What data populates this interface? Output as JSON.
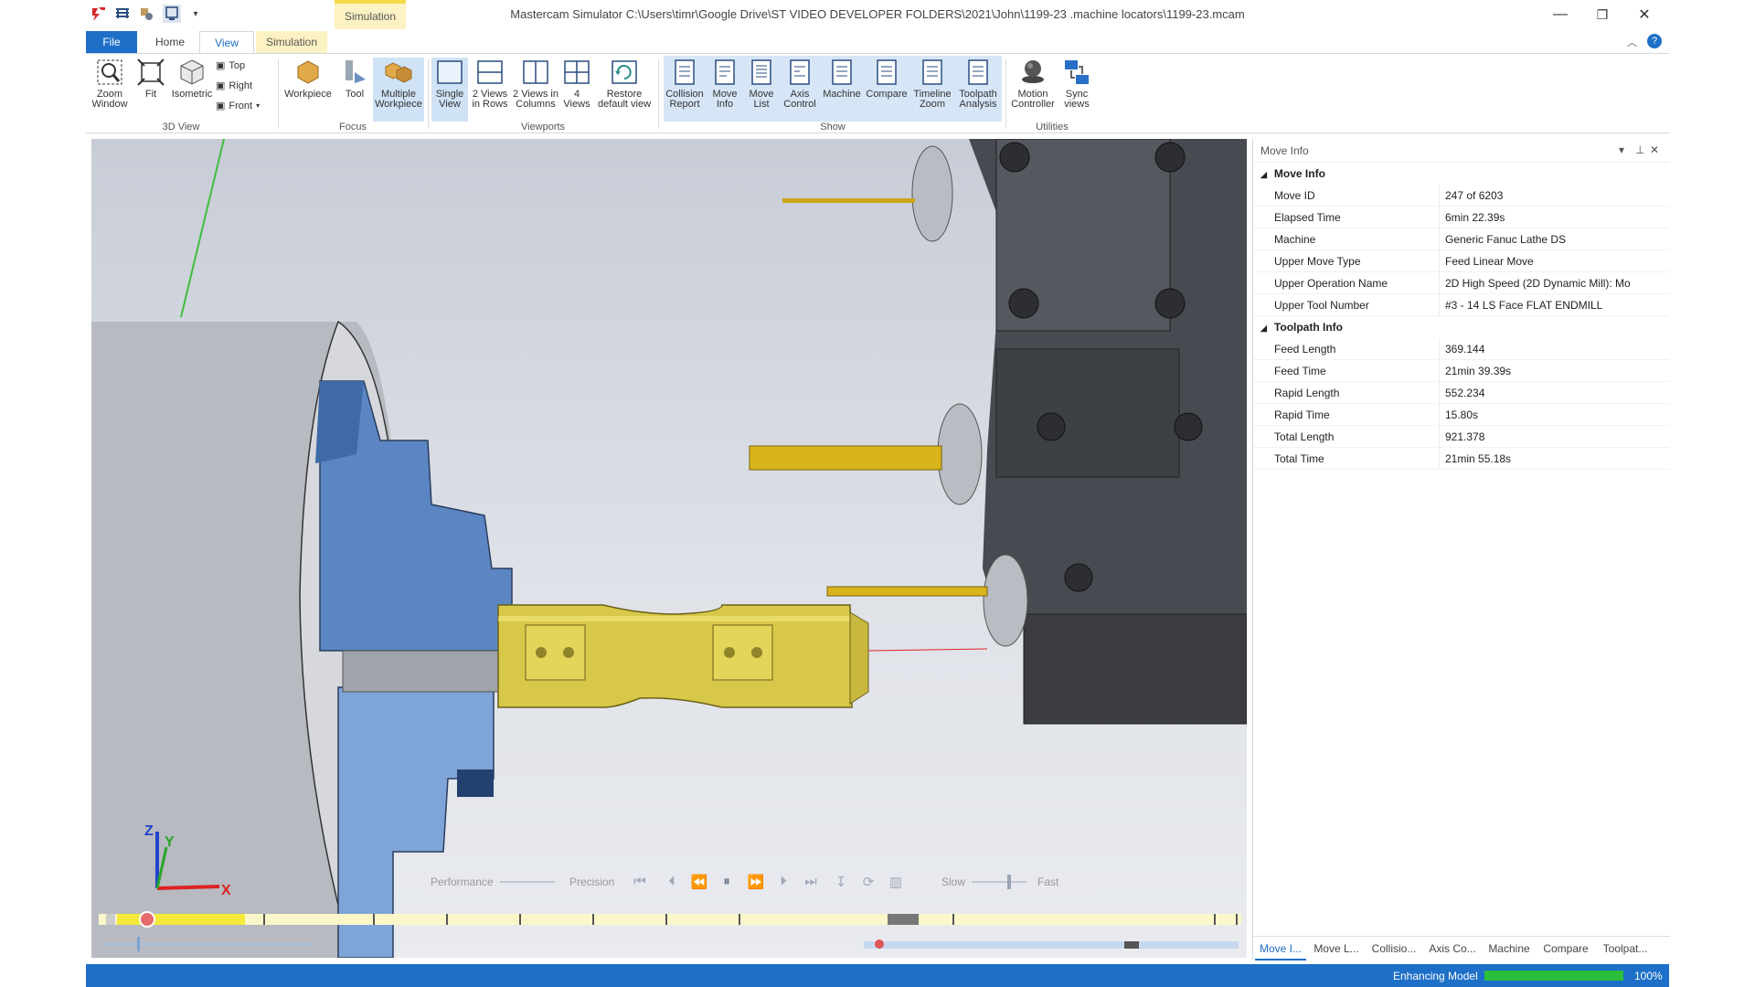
{
  "titlebar": {
    "title": "Mastercam Simulator  C:\\Users\\timr\\Google Drive\\ST VIDEO DEVELOPER FOLDERS\\2021\\John\\1199-23 .machine locators\\1199-23.mcam",
    "context_tab": "Simulation",
    "minimize": "—",
    "restore": "❐",
    "close": "✕"
  },
  "tabs": {
    "file": "File",
    "home": "Home",
    "view": "View",
    "simulation": "Simulation"
  },
  "ribbon": {
    "view3d": {
      "zoom_window": "Zoom Window",
      "fit": "Fit",
      "isometric": "Isometric",
      "top": "Top",
      "right": "Right",
      "front": "Front",
      "label": "3D View"
    },
    "focus": {
      "workpiece": "Workpiece",
      "tool": "Tool",
      "multiple_workpiece": "Multiple Workpiece",
      "label": "Focus"
    },
    "viewports": {
      "single_view": "Single View",
      "two_rows": "2 Views in Rows",
      "two_columns": "2 Views in Columns",
      "four_views": "4 Views",
      "restore_default": "Restore default view",
      "label": "Viewports"
    },
    "show": {
      "collision_report": "Collision Report",
      "move_info": "Move Info",
      "move_list": "Move List",
      "axis_control": "Axis Control",
      "machine": "Machine",
      "compare": "Compare",
      "timeline_zoom": "Timeline Zoom",
      "toolpath_analysis": "Toolpath Analysis",
      "label": "Show"
    },
    "utilities": {
      "motion_controller": "Motion Controller",
      "sync_views": "Sync views",
      "label": "Utilities"
    }
  },
  "playback": {
    "performance": "Performance",
    "precision": "Precision",
    "slow": "Slow",
    "fast": "Fast"
  },
  "panel": {
    "title": "Move Info",
    "sections": [
      {
        "name": "Move Info",
        "rows": [
          {
            "key": "Move ID",
            "value": "247 of 6203"
          },
          {
            "key": "Elapsed Time",
            "value": "6min 22.39s"
          },
          {
            "key": "Machine",
            "value": "Generic Fanuc Lathe DS"
          },
          {
            "key": "Upper Move Type",
            "value": "Feed Linear Move"
          },
          {
            "key": "Upper Operation Name",
            "value": "2D High Speed (2D Dynamic Mill): Mo"
          },
          {
            "key": "Upper Tool Number",
            "value": "#3 -  14 LS Face FLAT ENDMILL"
          }
        ]
      },
      {
        "name": "Toolpath Info",
        "rows": [
          {
            "key": "Feed Length",
            "value": "369.144"
          },
          {
            "key": "Feed Time",
            "value": "21min 39.39s"
          },
          {
            "key": "Rapid Length",
            "value": "552.234"
          },
          {
            "key": "Rapid Time",
            "value": "15.80s"
          },
          {
            "key": "Total Length",
            "value": "921.378"
          },
          {
            "key": "Total Time",
            "value": "21min 55.18s"
          }
        ]
      }
    ],
    "tabs": [
      "Move I...",
      "Move L...",
      "Collisio...",
      "Axis Co...",
      "Machine",
      "Compare",
      "Toolpat..."
    ]
  },
  "status": {
    "text": "Enhancing Model",
    "progress": 1.0,
    "progress_label": "100%"
  },
  "triad": {
    "x": "X",
    "y": "Y",
    "z": "Z"
  },
  "colors": {
    "accent": "#1d6fc7",
    "progress": "#2bbd3c",
    "part": "#d8c84a",
    "chuck": "#6b95cf"
  }
}
